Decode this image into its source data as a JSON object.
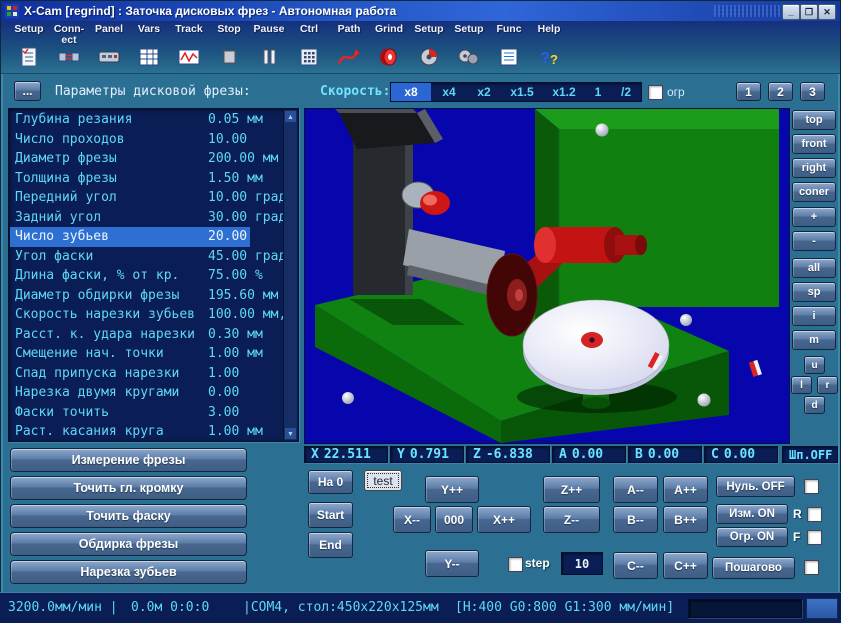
{
  "window": {
    "title": "X-Cam [regrind] : Заточка дисковых фрез - Автономная работа",
    "controls": {
      "minimize": "_",
      "maximize": "❐",
      "close": "✕"
    }
  },
  "icons": {
    "scroll_up": "▲",
    "scroll_down": "▼"
  },
  "toolbar": {
    "items": [
      {
        "label": "Setup",
        "icon": "checklist"
      },
      {
        "label": "Conn-ect",
        "icon": "connect"
      },
      {
        "label": "Panel",
        "icon": "panel"
      },
      {
        "label": "Vars",
        "icon": "vars-table"
      },
      {
        "label": "Track",
        "icon": "track-wave"
      },
      {
        "label": "Stop",
        "icon": "stop"
      },
      {
        "label": "Pause",
        "icon": "pause"
      },
      {
        "label": "Ctrl",
        "icon": "keypad"
      },
      {
        "label": "Path",
        "icon": "path-curve"
      },
      {
        "label": "Grind",
        "icon": "grind-wheel"
      },
      {
        "label": "Setup",
        "icon": "setup-wheel"
      },
      {
        "label": "Setup",
        "icon": "setup-wheels"
      },
      {
        "label": "Func",
        "icon": "func-list"
      },
      {
        "label": "Help",
        "icon": "help"
      }
    ]
  },
  "header": {
    "dots_button": "...",
    "params_title": "Параметры дисковой фрезы:",
    "speed_label": "Скорость:",
    "speed_options": [
      {
        "label": "x8",
        "selected": true
      },
      {
        "label": "x4"
      },
      {
        "label": "x2"
      },
      {
        "label": "x1.5"
      },
      {
        "label": "x1.2"
      },
      {
        "label": "1"
      },
      {
        "label": "/2"
      }
    ],
    "limit_checkbox_label": "огр",
    "preset_buttons": [
      "1",
      "2",
      "3"
    ]
  },
  "parameters": {
    "rows": [
      {
        "name": "Глубина резания",
        "value": "0.05 мм"
      },
      {
        "name": "Число проходов",
        "value": "10.00"
      },
      {
        "name": "Диаметр фрезы",
        "value": "200.00 мм"
      },
      {
        "name": "Толщина фрезы",
        "value": "1.50 мм"
      },
      {
        "name": "Передний угол",
        "value": "10.00 град"
      },
      {
        "name": "Задний угол",
        "value": "30.00 град"
      },
      {
        "name": "Число зубьев",
        "value": "20.00",
        "selected": true
      },
      {
        "name": "Угол фаски",
        "value": "45.00 град"
      },
      {
        "name": "Длина фаски, % от кр.",
        "value": "75.00 %"
      },
      {
        "name": "Диаметр обдирки фрезы",
        "value": "195.60 мм"
      },
      {
        "name": "Скорость нарезки зубьев",
        "value": "100.00 мм,"
      },
      {
        "name": "Расст. к. удара нарезки",
        "value": "0.30 мм"
      },
      {
        "name": "Смещение нач. точки",
        "value": "1.00 мм"
      },
      {
        "name": "Спад припуска нарезки",
        "value": "1.00"
      },
      {
        "name": "Нарезка двумя кругами",
        "value": "0.00"
      },
      {
        "name": "Фаски точить",
        "value": "3.00"
      },
      {
        "name": "Раст. касания круга",
        "value": "1.00 мм"
      }
    ]
  },
  "view_panel": {
    "views": [
      "top",
      "front",
      "right",
      "coner"
    ],
    "zoom": [
      "+",
      "-"
    ],
    "modes": [
      "all",
      "sp",
      "i",
      "m"
    ],
    "dpad": {
      "up": "u",
      "left": "l",
      "right": "r",
      "down": "d"
    }
  },
  "coordinates": {
    "axes": [
      {
        "axis": "X",
        "value": "22.511"
      },
      {
        "axis": "Y",
        "value": "0.791"
      },
      {
        "axis": "Z",
        "value": "-6.838"
      },
      {
        "axis": "A",
        "value": "0.00"
      },
      {
        "axis": "B",
        "value": "0.00"
      },
      {
        "axis": "C",
        "value": "0.00"
      }
    ],
    "spindle": "Шп.OFF"
  },
  "operations": [
    "Измерение фрезы",
    "Точить гл. кромку",
    "Точить фаску",
    "Обдирка фрезы",
    "Нарезка зубьев"
  ],
  "jog": {
    "na0": "На 0",
    "test": "test",
    "start": "Start",
    "end": "End",
    "y_plus": "Y++",
    "y_minus": "Y--",
    "x_minus": "X--",
    "zero": "000",
    "x_plus": "X++",
    "z_plus": "Z++",
    "z_minus": "Z--",
    "a_minus": "A--",
    "a_plus": "A++",
    "b_minus": "B--",
    "b_plus": "B++",
    "c_minus": "C--",
    "c_plus": "C++",
    "null_off": "Нуль. OFF",
    "izm_on": "Изм. ON",
    "ogr_on": "Огр. ON",
    "step_mode": "Пошагово",
    "step_label": "step",
    "step_value": "10",
    "r_label": "R",
    "f_label": "F"
  },
  "statusbar": {
    "feed": "3200.0мм/мин |",
    "distance": "0.0м 0:0:0",
    "port": "|COM4, стол:450x220x125мм",
    "limits": "[H:400 G0:800 G1:300 мм/мин]"
  },
  "colors": {
    "window_teal": "#2b7092",
    "titlebar_blue": "#2356c6",
    "panel_navy": "#0a1e55",
    "text_cyan": "#5fd8f8",
    "selection_blue": "#2e6fd2",
    "button_slate": "#5c7da8",
    "viewport_navy": "#0606ac",
    "machine_green": "#108010",
    "tool_red": "#c31313"
  }
}
